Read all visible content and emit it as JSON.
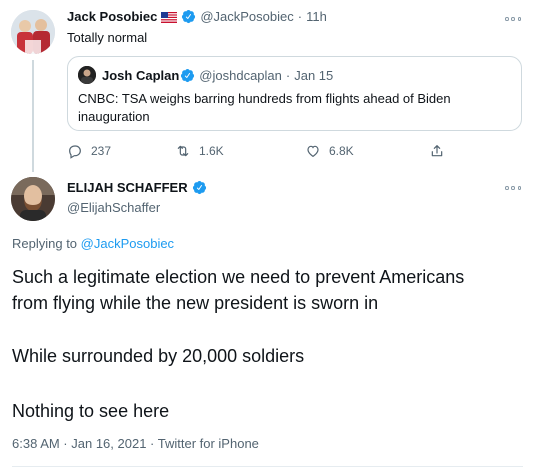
{
  "tweet1": {
    "name": "Jack Posobiec",
    "flag": "us-flag-icon",
    "handle": "@JackPosobiec",
    "time": "11h",
    "text": "Totally normal",
    "quote": {
      "name": "Josh Caplan",
      "handle": "@joshdcaplan",
      "date": "Jan 15",
      "text": "CNBC: TSA weighs barring hundreds from flights ahead of Biden inauguration"
    },
    "actions": {
      "replies": "237",
      "retweets": "1.6K",
      "likes": "6.8K"
    }
  },
  "tweet2": {
    "name": "ELIJAH SCHAFFER",
    "handle": "@ElijahSchaffer",
    "replying_prefix": "Replying to ",
    "replying_to": "@JackPosobiec",
    "lines": [
      "Such a legitimate election we need to prevent Americans",
      "from flying while the new president is sworn in",
      "While surrounded by 20,000 soldiers",
      "Nothing to see here"
    ],
    "meta": "6:38 AM · Jan 16, 2021 · Twitter for iPhone"
  },
  "separator": "·",
  "colors": {
    "link": "#1d9bf0",
    "muted": "#536471",
    "text": "#0f1419",
    "verified": "#1d9bf0"
  }
}
